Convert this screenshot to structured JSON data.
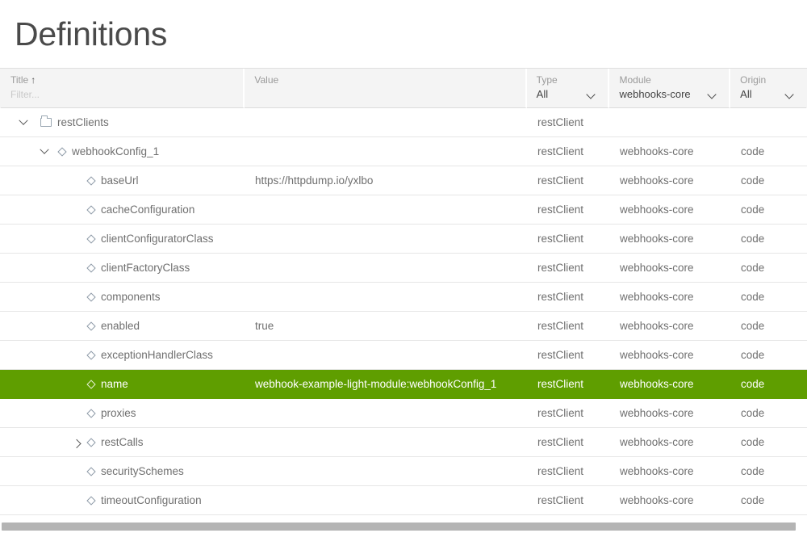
{
  "header": {
    "title": "Definitions"
  },
  "columns": [
    {
      "key": "title",
      "label": "Title",
      "sort": "↑",
      "filter_placeholder": "Filter..."
    },
    {
      "key": "value",
      "label": "Value",
      "filter_placeholder": ""
    },
    {
      "key": "type",
      "label": "Type",
      "selected": "All",
      "icon": "chevron-down-icon"
    },
    {
      "key": "module",
      "label": "Module",
      "selected": "webhooks-core",
      "icon": "chevron-down-icon"
    },
    {
      "key": "origin",
      "label": "Origin",
      "selected": "All",
      "icon": "chevron-down-icon"
    }
  ],
  "colors": {
    "selected_row": "#5f9e00",
    "header_bg": "#f4f4f4",
    "text": "#6f6f6f",
    "title_text": "#4a4a4a"
  },
  "rows": [
    {
      "title": "restClients",
      "value": "",
      "type": "restClient",
      "module": "",
      "origin": "",
      "depth": 0,
      "icon": "folder-icon",
      "expander": "open",
      "selected": false
    },
    {
      "title": "webhookConfig_1",
      "value": "",
      "type": "restClient",
      "module": "webhooks-core",
      "origin": "code",
      "depth": 1,
      "icon": "diamond-icon",
      "expander": "open",
      "selected": false
    },
    {
      "title": "baseUrl",
      "value": "https://httpdump.io/yxlbo",
      "type": "restClient",
      "module": "webhooks-core",
      "origin": "code",
      "depth": 2,
      "icon": "diamond-icon",
      "expander": "none",
      "selected": false
    },
    {
      "title": "cacheConfiguration",
      "value": "",
      "type": "restClient",
      "module": "webhooks-core",
      "origin": "code",
      "depth": 2,
      "icon": "diamond-icon",
      "expander": "none",
      "selected": false
    },
    {
      "title": "clientConfiguratorClass",
      "value": "",
      "type": "restClient",
      "module": "webhooks-core",
      "origin": "code",
      "depth": 2,
      "icon": "diamond-icon",
      "expander": "none",
      "selected": false
    },
    {
      "title": "clientFactoryClass",
      "value": "",
      "type": "restClient",
      "module": "webhooks-core",
      "origin": "code",
      "depth": 2,
      "icon": "diamond-icon",
      "expander": "none",
      "selected": false
    },
    {
      "title": "components",
      "value": "",
      "type": "restClient",
      "module": "webhooks-core",
      "origin": "code",
      "depth": 2,
      "icon": "diamond-icon",
      "expander": "none",
      "selected": false
    },
    {
      "title": "enabled",
      "value": "true",
      "type": "restClient",
      "module": "webhooks-core",
      "origin": "code",
      "depth": 2,
      "icon": "diamond-icon",
      "expander": "none",
      "selected": false
    },
    {
      "title": "exceptionHandlerClass",
      "value": "",
      "type": "restClient",
      "module": "webhooks-core",
      "origin": "code",
      "depth": 2,
      "icon": "diamond-icon",
      "expander": "none",
      "selected": false
    },
    {
      "title": "name",
      "value": "webhook-example-light-module:webhookConfig_1",
      "type": "restClient",
      "module": "webhooks-core",
      "origin": "code",
      "depth": 2,
      "icon": "diamond-icon",
      "expander": "none",
      "selected": true
    },
    {
      "title": "proxies",
      "value": "",
      "type": "restClient",
      "module": "webhooks-core",
      "origin": "code",
      "depth": 2,
      "icon": "diamond-icon",
      "expander": "none",
      "selected": false
    },
    {
      "title": "restCalls",
      "value": "",
      "type": "restClient",
      "module": "webhooks-core",
      "origin": "code",
      "depth": 2,
      "icon": "diamond-icon",
      "expander": "closed",
      "selected": false
    },
    {
      "title": "securitySchemes",
      "value": "",
      "type": "restClient",
      "module": "webhooks-core",
      "origin": "code",
      "depth": 2,
      "icon": "diamond-icon",
      "expander": "none",
      "selected": false
    },
    {
      "title": "timeoutConfiguration",
      "value": "",
      "type": "restClient",
      "module": "webhooks-core",
      "origin": "code",
      "depth": 2,
      "icon": "diamond-icon",
      "expander": "none",
      "selected": false
    }
  ],
  "scrollbar": {
    "orientation": "horizontal",
    "name": "horizontal-scrollbar"
  }
}
